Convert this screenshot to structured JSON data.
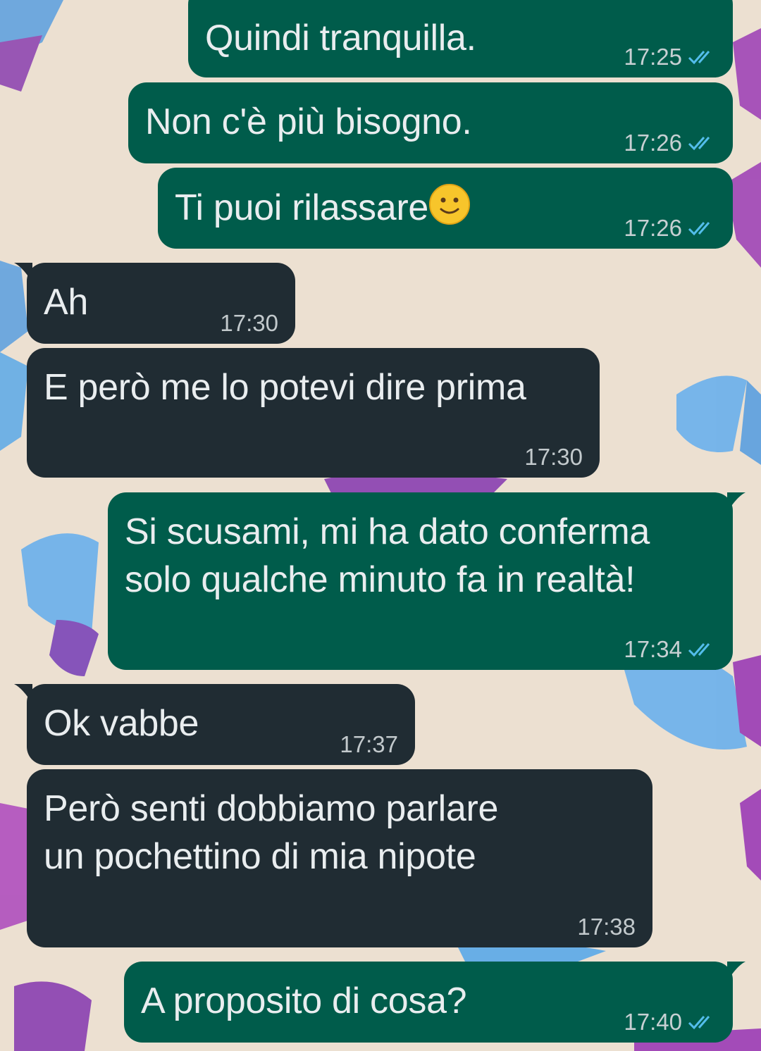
{
  "messages": [
    {
      "text": "Quindi tranquilla.",
      "time": "17:25",
      "outgoing": true,
      "read": true
    },
    {
      "text": "Non c'è più bisogno.",
      "time": "17:26",
      "outgoing": true,
      "read": true
    },
    {
      "text": "Ti puoi rilassare",
      "emoji": "slightly-smiling-face-icon",
      "time": "17:26",
      "outgoing": true,
      "read": true
    },
    {
      "text": "Ah",
      "time": "17:30",
      "outgoing": false
    },
    {
      "text": "E però me lo potevi dire prima",
      "time": "17:30",
      "outgoing": false
    },
    {
      "text_line1": "Si scusami, mi ha dato conferma",
      "text_line2": "solo qualche minuto fa in realtà!",
      "time": "17:34",
      "outgoing": true,
      "read": true
    },
    {
      "text": "Ok vabbe",
      "time": "17:37",
      "outgoing": false
    },
    {
      "text_line1": "Però senti dobbiamo parlare",
      "text_line2": "un pochettino di mia nipote",
      "time": "17:38",
      "outgoing": false
    },
    {
      "text": "A proposito di cosa?",
      "time": "17:40",
      "outgoing": true,
      "read": true
    }
  ],
  "colors": {
    "outgoing_bubble": "#005c4b",
    "incoming_bubble": "#202c33",
    "read_ticks": "#53bdeb",
    "wallpaper": "#ece0d1"
  }
}
